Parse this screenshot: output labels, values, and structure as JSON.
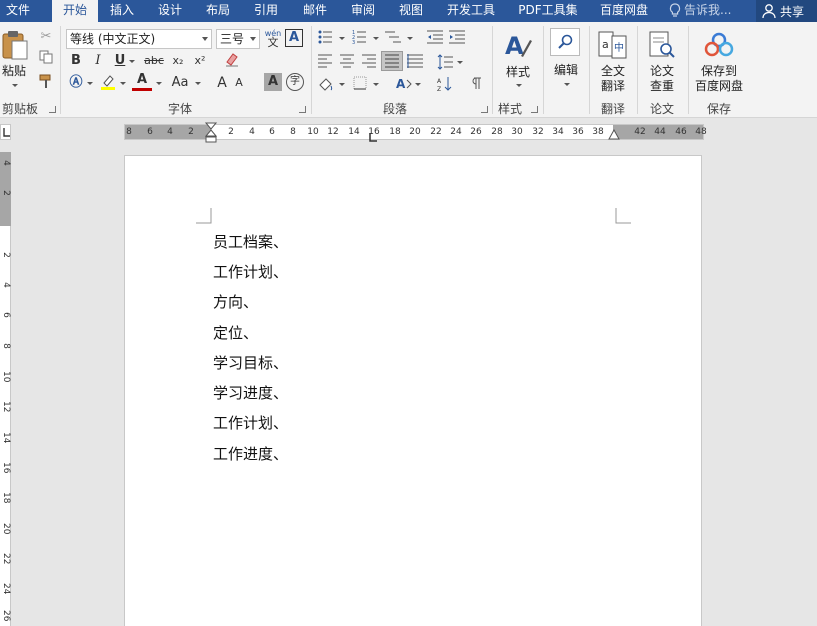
{
  "tabs": [
    {
      "label": "文件",
      "active": false
    },
    {
      "label": "开始",
      "active": true
    },
    {
      "label": "插入",
      "active": false
    },
    {
      "label": "设计",
      "active": false
    },
    {
      "label": "布局",
      "active": false
    },
    {
      "label": "引用",
      "active": false
    },
    {
      "label": "邮件",
      "active": false
    },
    {
      "label": "审阅",
      "active": false
    },
    {
      "label": "视图",
      "active": false
    },
    {
      "label": "开发工具",
      "active": false
    },
    {
      "label": "PDF工具集",
      "active": false
    },
    {
      "label": "百度网盘",
      "active": false
    }
  ],
  "tell_me": "告诉我...",
  "share": "共享",
  "clipboard": {
    "paste": "粘贴",
    "group": "剪贴板"
  },
  "font": {
    "name": "等线 (中文正文)",
    "size": "三号",
    "group": "字体",
    "bold": "B",
    "italic": "I",
    "underline": "U",
    "strike": "abc",
    "sub": "x₂",
    "sup": "x²",
    "grow": "A",
    "case": "Aa",
    "phonetic": "wén",
    "char_border": "A",
    "char_shading": "A",
    "enclose": "字"
  },
  "paragraph": {
    "group": "段落"
  },
  "styles": {
    "label": "样式",
    "group": "样式"
  },
  "editing": {
    "label": "编辑"
  },
  "translate": {
    "label1": "全文",
    "label2": "翻译",
    "group": "翻译"
  },
  "paper": {
    "label1": "论文",
    "label2": "查重",
    "group": "论文"
  },
  "save": {
    "label1": "保存到",
    "label2": "百度网盘",
    "group": "保存"
  },
  "ruler": {
    "left_numbers": [
      "8",
      "6",
      "4",
      "2"
    ],
    "right_numbers": [
      "2",
      "4",
      "6",
      "8",
      "10",
      "12",
      "14",
      "16",
      "18",
      "20",
      "22",
      "24",
      "26",
      "28",
      "30",
      "32",
      "34",
      "36",
      "38"
    ],
    "margin_numbers": [
      "42",
      "44",
      "46",
      "48"
    ]
  },
  "vruler": {
    "numbers": [
      "4",
      "2",
      "2",
      "4",
      "6",
      "8",
      "10",
      "12",
      "14",
      "16",
      "18",
      "20",
      "22",
      "24",
      "26"
    ]
  },
  "document": {
    "lines": [
      "员工档案、",
      "工作计划、",
      "方向、",
      "定位、",
      "学习目标、",
      "学习进度、",
      "工作计划、",
      "工作进度、"
    ]
  },
  "colors": {
    "accent": "#2b579a",
    "font_color": "#c00000",
    "highlight": "#ffff00"
  }
}
